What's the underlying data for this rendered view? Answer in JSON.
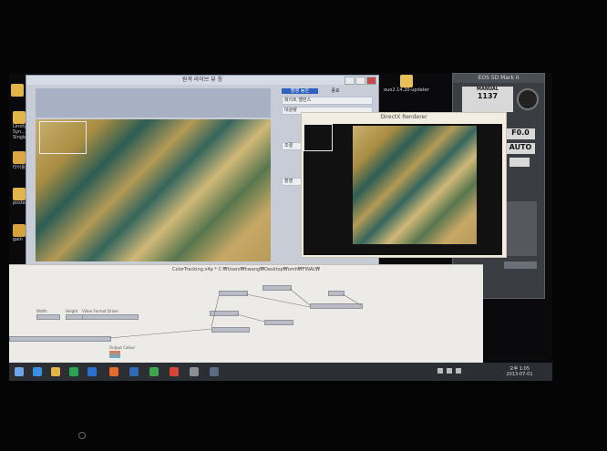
{
  "desktop_icons": [
    {
      "label": "Linotype Syn... Single...",
      "color": "#e2b54a"
    },
    {
      "label": "타이틀",
      "color": "#d9a842"
    },
    {
      "label": "poste",
      "color": "#e1b44c"
    },
    {
      "label": "gain",
      "color": "#d5a23e"
    },
    {
      "label": "euo2.14.20-updater",
      "color": "#e8c05a"
    }
  ],
  "camera_window": {
    "title": "원격 라이브 뷰 창",
    "buttons": [
      "촬영 동안",
      "종료"
    ],
    "side_labels": [
      "화이트 밸런스",
      "대광량",
      "조절",
      "촬영"
    ]
  },
  "directx_window": {
    "title": "DirectX Renderer"
  },
  "eos_panel": {
    "title": "EOS 5D Mark II",
    "mode": "MANUAL",
    "shutter": "1137",
    "aperture": "F0.0",
    "iso": "AUTO"
  },
  "patch_window": {
    "title": "ColorTracking.v4p *   C:₩Users₩hwang₩Desktop₩omh₩FINAL₩",
    "labels": [
      "Width",
      "Height",
      "Video Format Driver",
      "Output Colour"
    ]
  },
  "taskbar": {
    "clock": "오후 1:05",
    "date": "2013-07-01",
    "icons": [
      {
        "name": "start-icon",
        "color": "#6fa4e6"
      },
      {
        "name": "ie-icon",
        "color": "#3a8de0"
      },
      {
        "name": "explorer-icon",
        "color": "#e2b54a"
      },
      {
        "name": "store-icon",
        "color": "#2aa354"
      },
      {
        "name": "vvvv-icon",
        "color": "#2c6fd0"
      },
      {
        "name": "firefox-icon",
        "color": "#e66b2c"
      },
      {
        "name": "photoshop-icon",
        "color": "#2f6bb5"
      },
      {
        "name": "chrome-icon",
        "color": "#3fa650"
      },
      {
        "name": "app-icon",
        "color": "#d5453a"
      },
      {
        "name": "window-icon",
        "color": "#8a8f98"
      },
      {
        "name": "camera-icon",
        "color": "#5a6a80"
      }
    ]
  }
}
